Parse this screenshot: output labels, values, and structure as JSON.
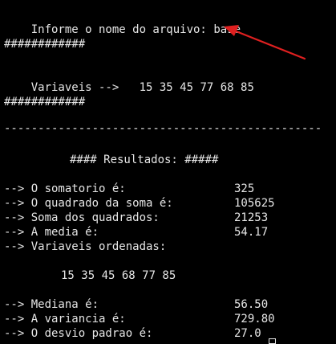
{
  "prompt": {
    "label": "Informe o nome do arquivo:",
    "value": "base"
  },
  "hash_line_top": "############",
  "variables_line": {
    "label": "Variaveis -->",
    "values": "15 35 45 77 68 85"
  },
  "hash_line_bottom": "############",
  "separator": "-----------------------------------------------",
  "results_header": "#### Resultados: #####",
  "results": [
    {
      "label": "--> O somatorio é:",
      "value": "325"
    },
    {
      "label": "--> O quadrado da soma é:",
      "value": "105625"
    },
    {
      "label": "--> Soma dos quadrados:",
      "value": "21253"
    },
    {
      "label": "--> A media é:",
      "value": "54.17"
    }
  ],
  "sorted_label": "--> Variaveis ordenadas:",
  "sorted_values": "15 35 45 68 77 85",
  "stats": [
    {
      "label": "--> Mediana é:",
      "value": "56.50"
    },
    {
      "label": "--> A variancia é:",
      "value": "729.80"
    },
    {
      "label": "--> O desvio padrao é:",
      "value": "27.0"
    }
  ],
  "annotation": {
    "arrow_color": "#e02020"
  },
  "colors": {
    "background": "#000000",
    "text": "#e6e6e6"
  }
}
